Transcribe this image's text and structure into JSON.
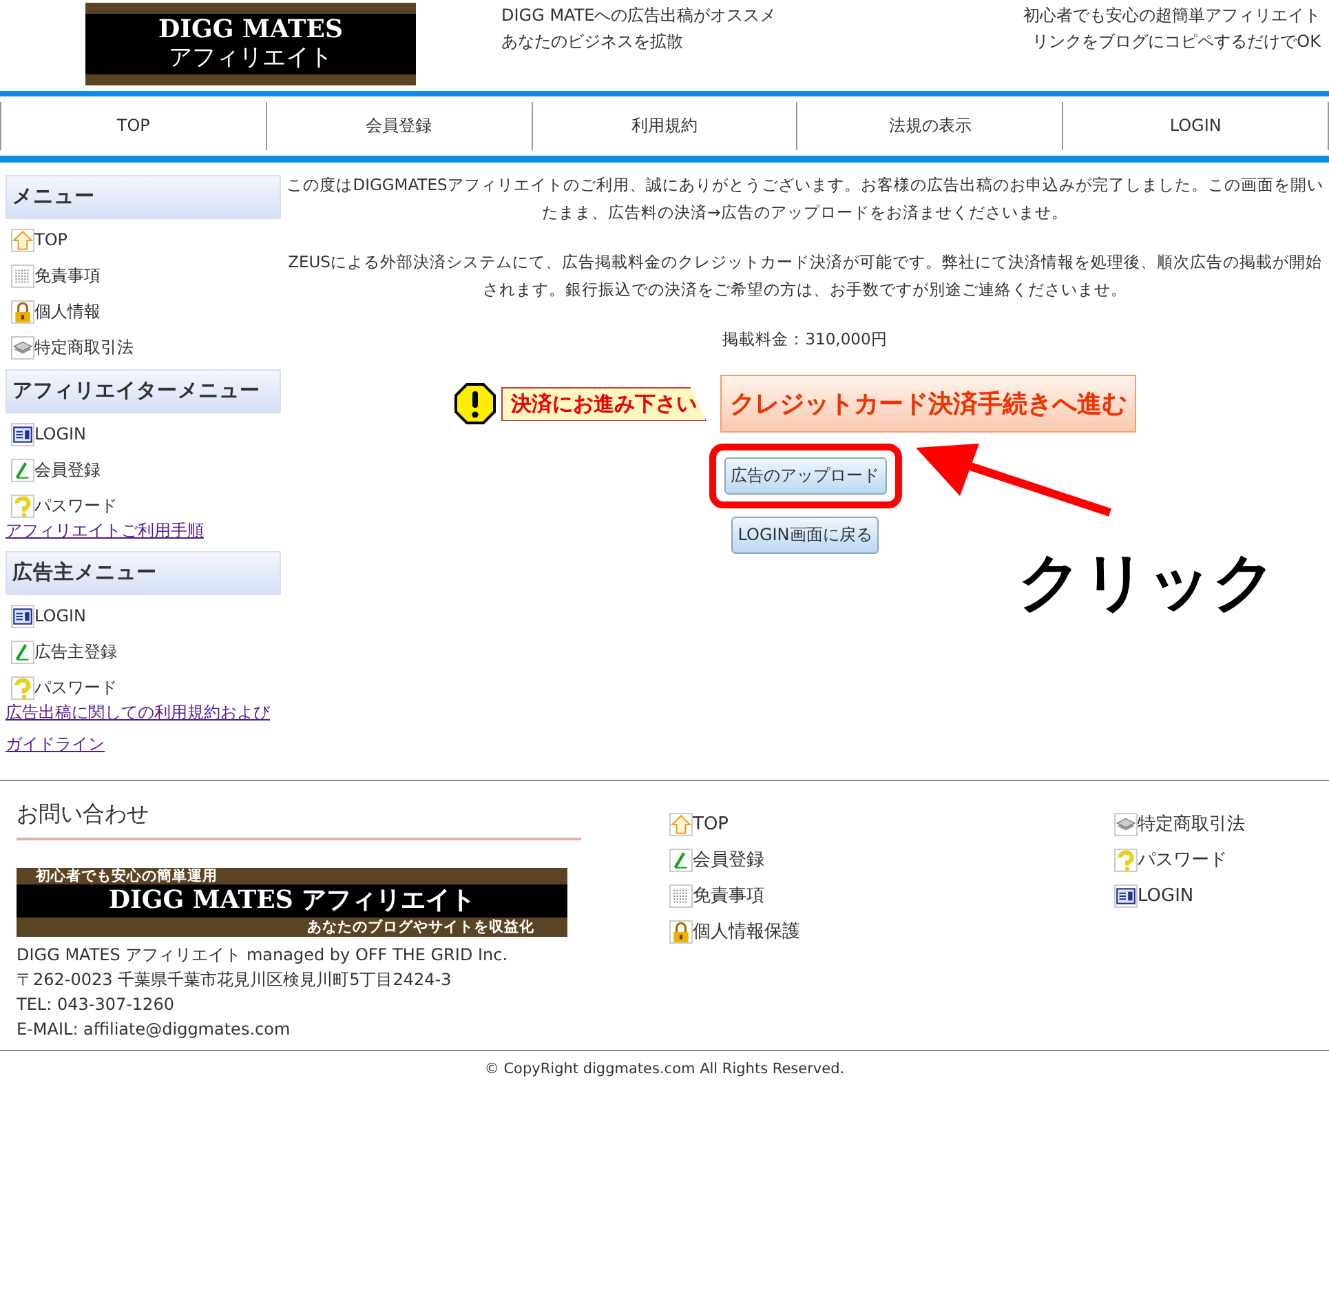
{
  "header": {
    "logo": {
      "line_1": "DIGG MATES",
      "line_2": "アフィリエイト"
    },
    "tagline_left": [
      "DIGG MATEへの広告出稿がオススメ",
      "あなたのビジネスを拡散"
    ],
    "tagline_right": [
      "初心者でも安心の超簡単アフィリエイト",
      "リンクをブログにコピペするだけでOK"
    ]
  },
  "nav": [
    "TOP",
    "会員登録",
    "利用規約",
    "法規の表示",
    "LOGIN"
  ],
  "sidebar": [
    {
      "kind": "heading",
      "label": "メニュー"
    },
    {
      "kind": "house",
      "label": "TOP"
    },
    {
      "kind": "grid",
      "label": "免責事項"
    },
    {
      "kind": "lock",
      "label": "個人情報"
    },
    {
      "kind": "stack",
      "label": "特定商取引法"
    },
    {
      "kind": "heading",
      "label": "アフィリエイターメニュー"
    },
    {
      "kind": "card",
      "label": "LOGIN"
    },
    {
      "kind": "pencil",
      "label": "会員登録"
    },
    {
      "kind": "question",
      "label": "パスワード"
    },
    {
      "kind": "link",
      "label": "アフィリエイトご利用手順"
    },
    {
      "kind": "heading",
      "label": "広告主メニュー"
    },
    {
      "kind": "card",
      "label": "LOGIN"
    },
    {
      "kind": "pencil",
      "label": "広告主登録"
    },
    {
      "kind": "question",
      "label": "パスワード"
    },
    {
      "kind": "link",
      "label": "広告出稿に関しての利用規約およびガイドライン"
    }
  ],
  "main": {
    "paragraphs": [
      "この度はDIGGMATESアフィリエイトのご利用、誠にありがとうございます。お客様の広告出稿のお申込みが完了しました。この画面を開いたまま、広告料の決済→広告のアップロードをお済ませくださいませ。",
      "ZEUSによる外部決済システムにて、広告掲載料金のクレジットカード決済が可能です。弊社にて決済情報を処理後、順次広告の掲載が開始されます。銀行振込での決済をご希望の方は、お手数ですが別途ご連絡くださいませ。"
    ],
    "fee": "掲載料金：310,000円",
    "notice": "決済にお進み下さい",
    "pay_button": "クレジットカード決済手続きへ進む",
    "upload_button": "広告のアップロード",
    "back_button": "LOGIN画面に戻る",
    "annotation": "クリック"
  },
  "footer": {
    "contact_title": "お問い合わせ",
    "banner": {
      "top": "初心者でも安心の簡単運用",
      "middle_latin": "DIGG MATES",
      "middle_kana": "アフィリエイト",
      "bottom": "あなたのブログやサイトを収益化"
    },
    "address": [
      "DIGG MATES アフィリエイト managed by OFF THE GRID Inc.",
      "〒262-0023 千葉県千葉市花見川区検見川町5丁目2424-3",
      "TEL: 043-307-1260",
      "E-MAIL: affiliate@diggmates.com"
    ],
    "links_1": [
      {
        "kind": "house",
        "label": "TOP"
      },
      {
        "kind": "pencil",
        "label": "会員登録"
      },
      {
        "kind": "grid",
        "label": "免責事項"
      },
      {
        "kind": "lock",
        "label": "個人情報保護"
      }
    ],
    "links_2": [
      {
        "kind": "stack",
        "label": "特定商取引法"
      },
      {
        "kind": "question",
        "label": "パスワード"
      },
      {
        "kind": "card",
        "label": "LOGIN"
      }
    ],
    "copyright": "© CopyRight diggmates.com All Rights Reserved."
  }
}
